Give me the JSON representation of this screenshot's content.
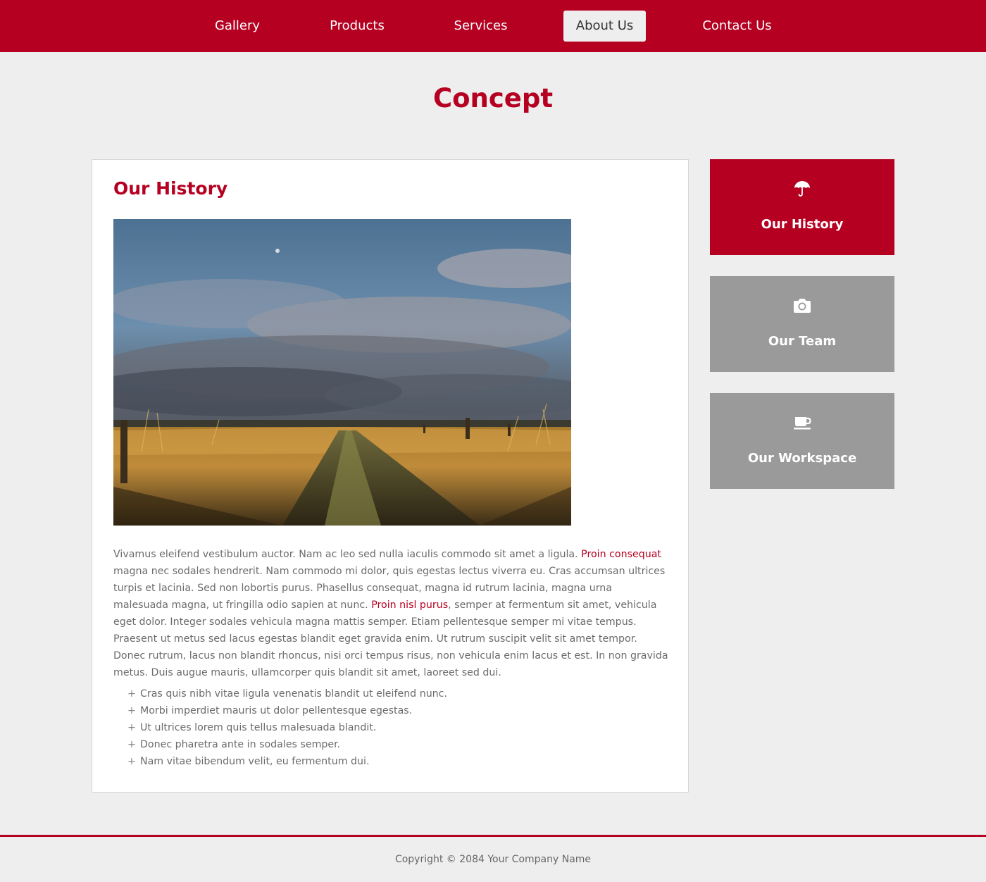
{
  "nav": {
    "items": [
      {
        "label": "Gallery",
        "active": false
      },
      {
        "label": "Products",
        "active": false
      },
      {
        "label": "Services",
        "active": false
      },
      {
        "label": "About Us",
        "active": true
      },
      {
        "label": "Contact Us",
        "active": false
      }
    ]
  },
  "page": {
    "title": "Concept"
  },
  "main": {
    "heading": "Our History",
    "image_alt": "Dirt path through golden grass field under a cloudy sky",
    "paragraph": {
      "part1": "Vivamus eleifend vestibulum auctor. Nam ac leo sed nulla iaculis commodo sit amet a ligula. ",
      "link1": "Proin consequat",
      "part2": " magna nec sodales hendrerit. Nam commodo mi dolor, quis egestas lectus viverra eu. Cras accumsan ultrices turpis et lacinia. Sed non lobortis purus. Phasellus consequat, magna id rutrum lacinia, magna urna malesuada magna, ut fringilla odio sapien at nunc. ",
      "link2": "Proin nisl purus",
      "part3": ", semper at fermentum sit amet, vehicula eget dolor. Integer sodales vehicula magna mattis semper. Etiam pellentesque semper mi vitae tempus. Praesent ut metus sed lacus egestas blandit eget gravida enim. Ut rutrum suscipit velit sit amet tempor. Donec rutrum, lacus non blandit rhoncus, nisi orci tempus risus, non vehicula enim lacus et est. In non gravida metus. Duis augue mauris, ullamcorper quis blandit sit amet, laoreet sed dui."
    },
    "list_marker": "+",
    "list": [
      "Cras quis nibh vitae ligula venenatis blandit ut eleifend nunc.",
      "Morbi imperdiet mauris ut dolor pellentesque egestas.",
      "Ut ultrices lorem quis tellus malesuada blandit.",
      "Donec pharetra ante in sodales semper.",
      "Nam vitae bibendum velit, eu fermentum dui."
    ]
  },
  "sidebar": {
    "items": [
      {
        "label": "Our History",
        "icon": "umbrella-icon",
        "active": true
      },
      {
        "label": "Our Team",
        "icon": "camera-icon",
        "active": false
      },
      {
        "label": "Our Workspace",
        "icon": "coffee-cup-icon",
        "active": false
      }
    ]
  },
  "footer": {
    "copyright": "Copyright © 2084 Your Company Name"
  },
  "colors": {
    "brand": "#b50021",
    "background": "#eeeeee",
    "sidebar_inactive": "#9a9a9a",
    "text": "#666666"
  }
}
